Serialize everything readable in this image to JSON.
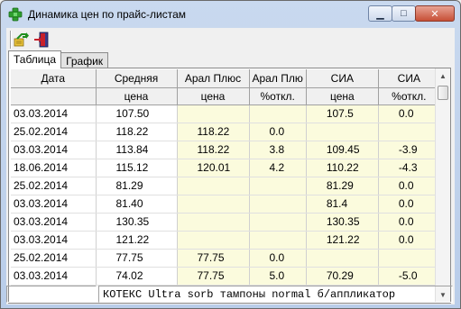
{
  "window": {
    "title": "Динамика цен по прайс-листам",
    "icon": "green-cross-icon"
  },
  "titlebar_buttons": {
    "minimize": "minimize-icon",
    "maximize": "maximize-icon",
    "close": "close-icon"
  },
  "toolbar": {
    "items": [
      "refresh-icon",
      "exit-door-icon"
    ]
  },
  "tabs": [
    {
      "label": "Таблица",
      "active": true
    },
    {
      "label": "График",
      "active": false
    }
  ],
  "grid": {
    "headers_row1": [
      "Дата",
      "Средняя",
      "Арал Плюс",
      "Арал Плю",
      "СИА",
      "СИА"
    ],
    "headers_row2": [
      "",
      "цена",
      "цена",
      "%откл.",
      "цена",
      "%откл."
    ],
    "rows": [
      [
        "03.03.2014",
        "107.50",
        "",
        "",
        "107.5",
        "0.0"
      ],
      [
        "25.02.2014",
        "118.22",
        "118.22",
        "0.0",
        "",
        ""
      ],
      [
        "03.03.2014",
        "113.84",
        "118.22",
        "3.8",
        "109.45",
        "-3.9"
      ],
      [
        "18.06.2014",
        "115.12",
        "120.01",
        "4.2",
        "110.22",
        "-4.3"
      ],
      [
        "25.02.2014",
        "81.29",
        "",
        "",
        "81.29",
        "0.0"
      ],
      [
        "03.03.2014",
        "81.40",
        "",
        "",
        "81.4",
        "0.0"
      ],
      [
        "03.03.2014",
        "130.35",
        "",
        "",
        "130.35",
        "0.0"
      ],
      [
        "03.03.2014",
        "121.22",
        "",
        "",
        "121.22",
        "0.0"
      ],
      [
        "25.02.2014",
        "77.75",
        "77.75",
        "0.0",
        "",
        ""
      ],
      [
        "03.03.2014",
        "74.02",
        "77.75",
        "5.0",
        "70.29",
        "-5.0"
      ]
    ],
    "row_highlight_color": "#fbfbdd"
  },
  "scrollbar": {
    "up": "scroll-up-icon",
    "down": "scroll-down-icon"
  },
  "status": {
    "product": "КОТЕКС Ultra sorb тампоны normal б/аппликатор"
  }
}
